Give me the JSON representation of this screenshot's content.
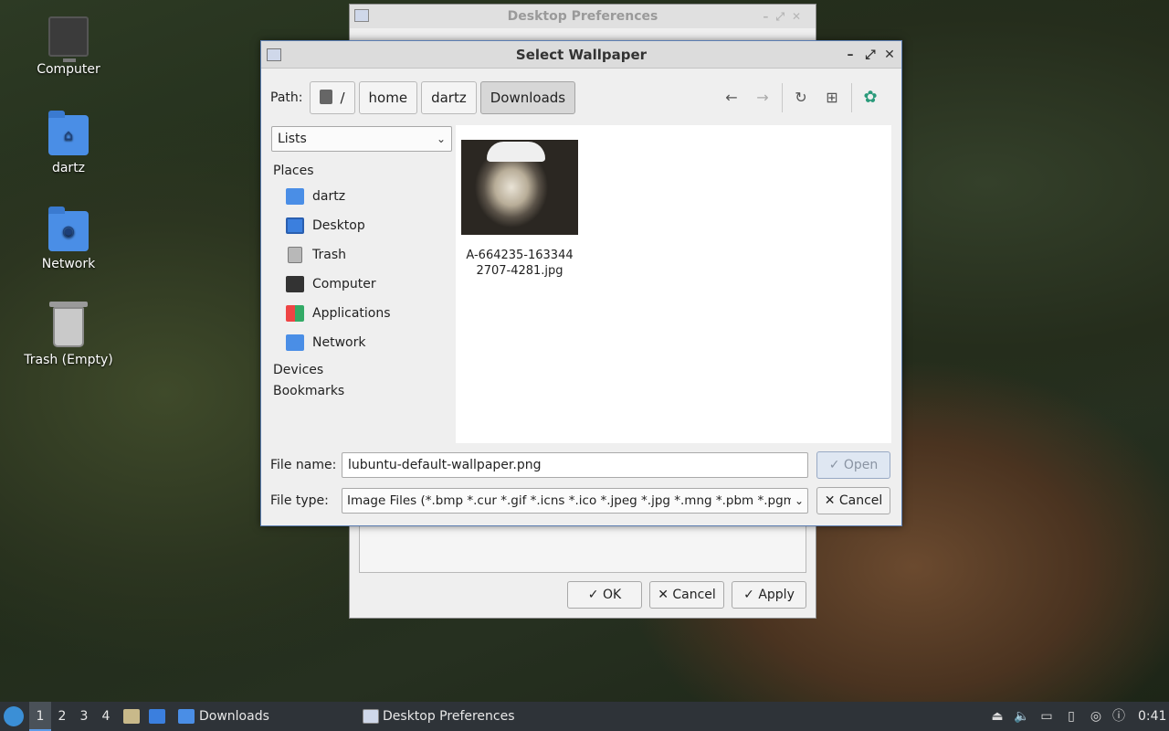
{
  "desktop": {
    "icons": [
      {
        "label": "Computer",
        "icon": "computer-icon"
      },
      {
        "label": "dartz",
        "icon": "home-folder-icon"
      },
      {
        "label": "Network",
        "icon": "network-folder-icon"
      },
      {
        "label": "Trash (Empty)",
        "icon": "trash-icon"
      }
    ]
  },
  "background_window": {
    "title": "Desktop Preferences",
    "buttons": {
      "ok": "OK",
      "cancel": "Cancel",
      "apply": "Apply"
    }
  },
  "dialog": {
    "title": "Select Wallpaper",
    "path_label": "Path:",
    "breadcrumbs": [
      "/",
      "home",
      "dartz",
      "Downloads"
    ],
    "view_mode": "Lists",
    "sidebar": {
      "places_header": "Places",
      "places": [
        {
          "label": "dartz",
          "icon": "home-folder-icon"
        },
        {
          "label": "Desktop",
          "icon": "desktop-icon"
        },
        {
          "label": "Trash",
          "icon": "trash-icon"
        },
        {
          "label": "Computer",
          "icon": "computer-icon"
        },
        {
          "label": "Applications",
          "icon": "applications-icon"
        },
        {
          "label": "Network",
          "icon": "network-icon"
        }
      ],
      "devices_header": "Devices",
      "bookmarks_header": "Bookmarks"
    },
    "files": [
      {
        "name_line1": "A-664235-163344",
        "name_line2": "2707-4281.jpg"
      }
    ],
    "file_name_label": "File name:",
    "file_name_value": "lubuntu-default-wallpaper.png",
    "file_type_label": "File type:",
    "file_type_value": "Image Files (*.bmp *.cur *.gif *.icns *.ico *.jpeg *.jpg *.mng *.pbm *.pgm",
    "open_label": "Open",
    "cancel_label": "Cancel"
  },
  "taskbar": {
    "workspaces": [
      "1",
      "2",
      "3",
      "4"
    ],
    "active_workspace": "1",
    "tasks": [
      "Downloads",
      "Desktop Preferences"
    ],
    "clock": "0:41"
  }
}
